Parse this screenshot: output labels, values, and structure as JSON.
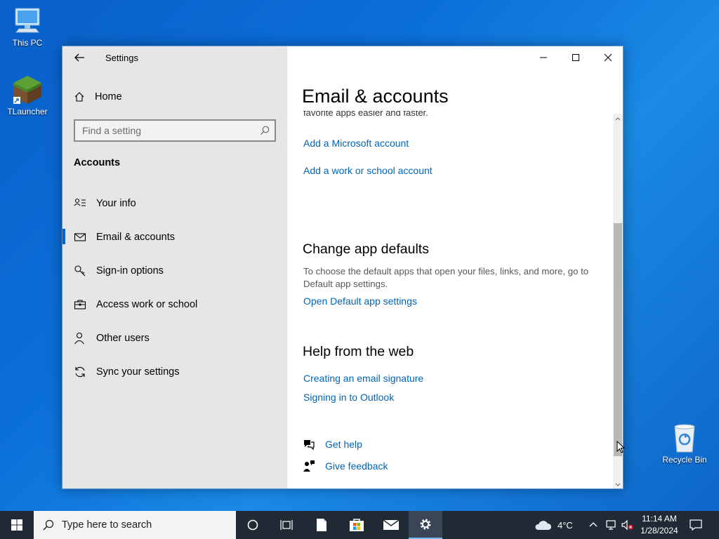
{
  "desktop": {
    "icons": [
      {
        "label": "This PC"
      },
      {
        "label": "TLauncher"
      },
      {
        "label": "Recycle Bin"
      }
    ]
  },
  "window": {
    "app_title": "Settings",
    "sidebar": {
      "home_label": "Home",
      "search_placeholder": "Find a setting",
      "section_label": "Accounts",
      "items": [
        {
          "label": "Your info",
          "icon": "person-card-icon"
        },
        {
          "label": "Email & accounts",
          "icon": "mail-icon",
          "active": true
        },
        {
          "label": "Sign-in options",
          "icon": "key-icon"
        },
        {
          "label": "Access work or school",
          "icon": "briefcase-icon"
        },
        {
          "label": "Other users",
          "icon": "person-add-icon"
        },
        {
          "label": "Sync your settings",
          "icon": "sync-icon"
        }
      ]
    },
    "content": {
      "page_title": "Email & accounts",
      "clipped_text": "favorite apps easier and faster.",
      "links_top": [
        "Add a Microsoft account",
        "Add a work or school account"
      ],
      "change_defaults": {
        "heading": "Change app defaults",
        "description": "To choose the default apps that open your files, links, and more, go to Default app settings.",
        "link": "Open Default app settings"
      },
      "help": {
        "heading": "Help from the web",
        "links": [
          "Creating an email signature",
          "Signing in to Outlook"
        ]
      },
      "get_help": "Get help",
      "give_feedback": "Give feedback"
    }
  },
  "taskbar": {
    "search_placeholder": "Type here to search",
    "weather": "4°C",
    "time": "11:14 AM",
    "date": "1/28/2024",
    "accent": "#0067c0"
  }
}
